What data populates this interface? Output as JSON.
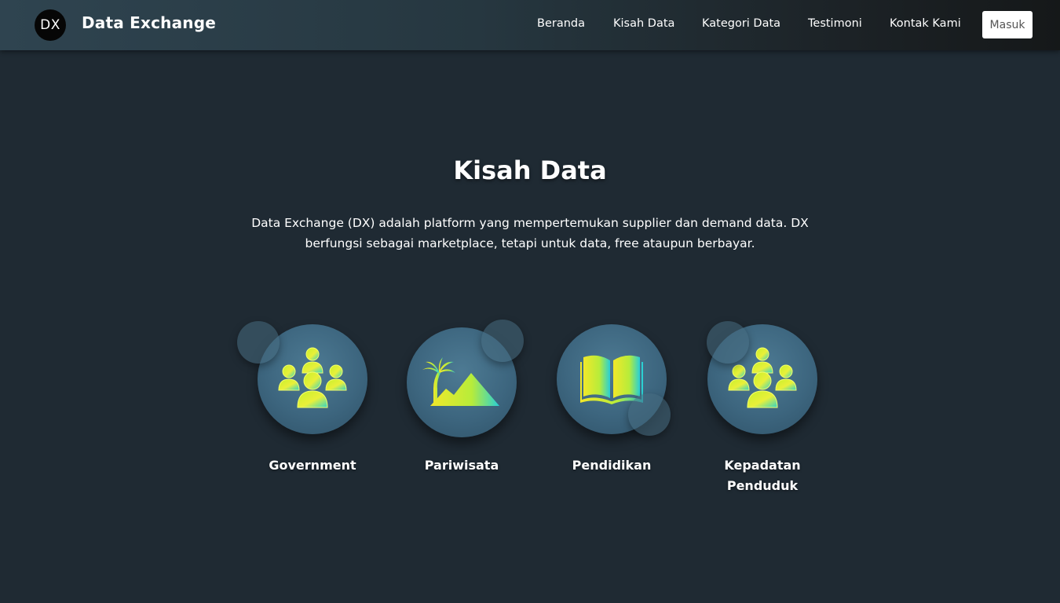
{
  "brand": {
    "logo_text": "DX",
    "name": "Data Exchange"
  },
  "nav": {
    "items": [
      {
        "label": "Beranda"
      },
      {
        "label": "Kisah Data"
      },
      {
        "label": "Kategori Data"
      },
      {
        "label": "Testimoni"
      },
      {
        "label": "Kontak Kami"
      }
    ],
    "login_label": "Masuk"
  },
  "hero": {
    "title": "Kisah Data",
    "description": "Data Exchange (DX) adalah platform yang mempertemukan supplier dan demand data. DX berfungsi sebagai marketplace, tetapi untuk data, free ataupun berbayar."
  },
  "categories": [
    {
      "label": "Government",
      "icon": "people-group-icon"
    },
    {
      "label": "Pariwisata",
      "icon": "beach-landscape-icon"
    },
    {
      "label": "Pendidikan",
      "icon": "open-book-icon"
    },
    {
      "label": "Kepadatan Penduduk",
      "icon": "people-group-icon"
    }
  ],
  "colors": {
    "background": "#1f2a33",
    "circle": "#3d667f",
    "icon_gradient_start": "#c8f02a",
    "icon_gradient_end": "#2fd3c8"
  }
}
